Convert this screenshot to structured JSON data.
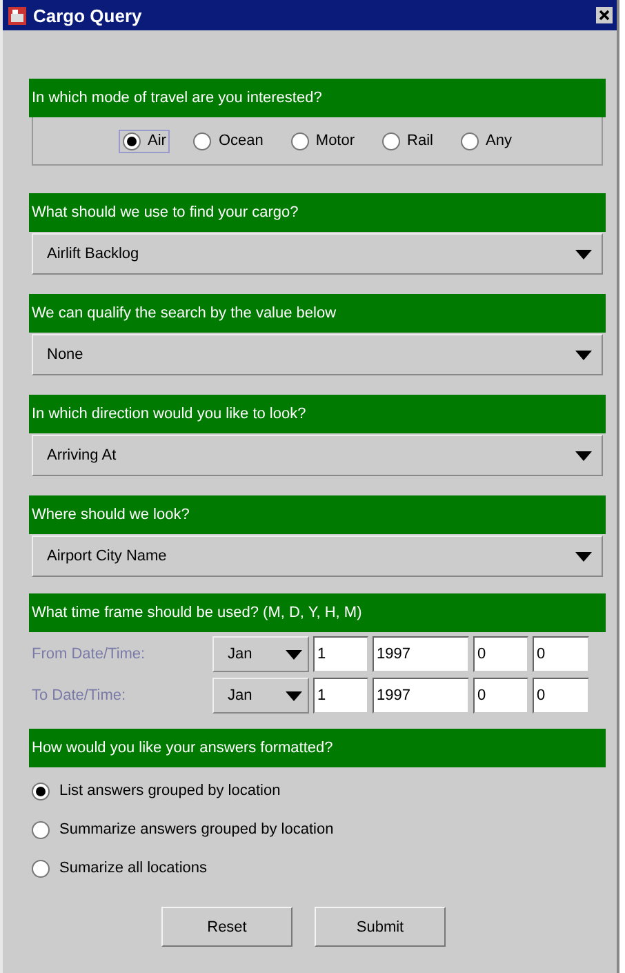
{
  "window": {
    "title": "Cargo Query"
  },
  "sections": [
    {
      "kind": "radio_row",
      "heading": "In which mode of travel are you interested?",
      "options": [
        {
          "label": "Air",
          "selected": true
        },
        {
          "label": "Ocean",
          "selected": false
        },
        {
          "label": "Motor",
          "selected": false
        },
        {
          "label": "Rail",
          "selected": false
        },
        {
          "label": "Any",
          "selected": false
        }
      ]
    },
    {
      "kind": "combo",
      "heading": "What should we use to find your cargo?",
      "value": "Airlift Backlog"
    },
    {
      "kind": "combo",
      "heading": "We can qualify the search by the value below",
      "value": "None"
    },
    {
      "kind": "combo",
      "heading": "In which direction would you like to look?",
      "value": "Arriving At"
    },
    {
      "kind": "combo",
      "heading": "Where should we look?",
      "value": "Airport City Name"
    },
    {
      "kind": "time",
      "heading": "What time frame should be used? (M, D, Y, H, M)",
      "rows": [
        {
          "label": "From Date/Time:",
          "month": "Jan",
          "day": "1",
          "year": "1997",
          "hour": "0",
          "minute": "0"
        },
        {
          "label": "To Date/Time:",
          "month": "Jan",
          "day": "1",
          "year": "1997",
          "hour": "0",
          "minute": "0"
        }
      ]
    },
    {
      "kind": "radio_list",
      "heading": "How would you like your answers formatted?",
      "options": [
        {
          "label": "List answers grouped by location",
          "selected": true
        },
        {
          "label": "Summarize answers grouped by location",
          "selected": false
        },
        {
          "label": "Sumarize all locations",
          "selected": false
        }
      ]
    }
  ],
  "buttons": [
    "Reset",
    "Submit"
  ]
}
